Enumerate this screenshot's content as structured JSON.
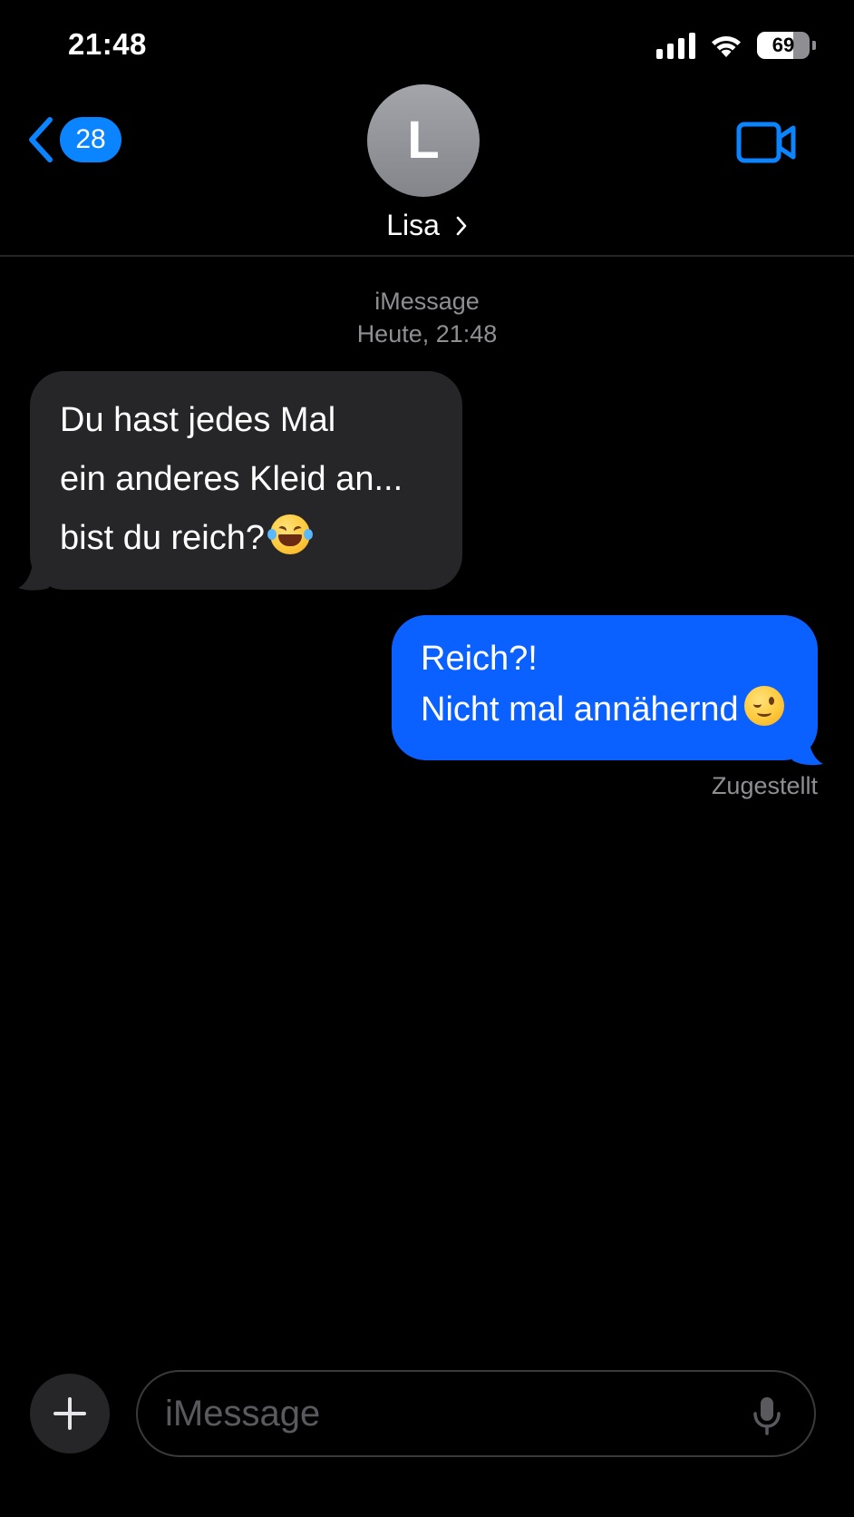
{
  "status_bar": {
    "time": "21:48",
    "signal_bars": 4,
    "wifi": "wifi-icon",
    "battery_level": "69",
    "battery_fraction": 0.69
  },
  "header": {
    "back_count": "28",
    "avatar_initial": "L",
    "contact_name": "Lisa",
    "icons": [
      "chevron-left-icon",
      "chevron-right-icon",
      "video-camera-icon"
    ]
  },
  "conversation": {
    "service_label": "iMessage",
    "timestamp": "Heute, 21:48",
    "messages": [
      {
        "direction": "incoming",
        "lines": [
          "Du hast jedes Mal",
          "ein anderes Kleid an...",
          "bist du reich?"
        ],
        "emoji": "face-with-tears-of-joy"
      },
      {
        "direction": "outgoing",
        "lines": [
          "Reich?!",
          "Nicht mal annähernd"
        ],
        "emoji": "winking-face"
      }
    ],
    "delivery_status": "Zugestellt"
  },
  "compose": {
    "placeholder": "iMessage",
    "value": "",
    "icons": [
      "plus-icon",
      "microphone-icon"
    ]
  },
  "colors": {
    "background": "#000000",
    "accent_blue": "#0a84ff",
    "outgoing_bubble": "#0b61ff",
    "incoming_bubble": "#262628",
    "secondary_text": "#8e8e93"
  }
}
